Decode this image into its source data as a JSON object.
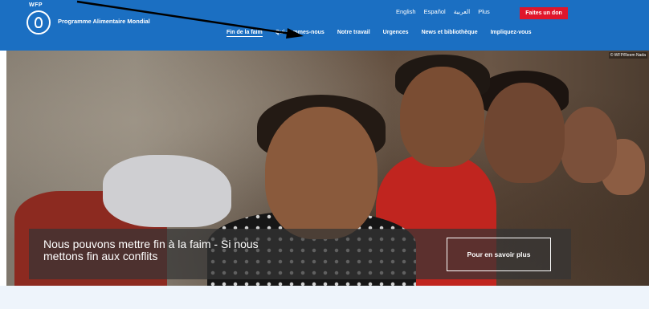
{
  "brand": {
    "wordmark": "WFP",
    "name": "Programme Alimentaire Mondial"
  },
  "languages": [
    "English",
    "Español",
    "العربية",
    "Plus"
  ],
  "donate_label": "Faites un don",
  "nav": [
    {
      "label": "Fin de la faim",
      "active": true
    },
    {
      "label": "Qui sommes-nous",
      "active": false
    },
    {
      "label": "Notre travail",
      "active": false
    },
    {
      "label": "Urgences",
      "active": false
    },
    {
      "label": "News et bibliothèque",
      "active": false
    },
    {
      "label": "Impliquez-vous",
      "active": false
    }
  ],
  "hero": {
    "photo_credit": "© WFP/Reem Nada",
    "headline": "Nous pouvons mettre fin à la faim - Si nous mettons fin aux conflits",
    "cta_label": "Pour en savoir plus"
  },
  "colors": {
    "header_bg": "#1b6fc2",
    "donate_bg": "#e0162b",
    "band_bg": "#eef4fb"
  }
}
